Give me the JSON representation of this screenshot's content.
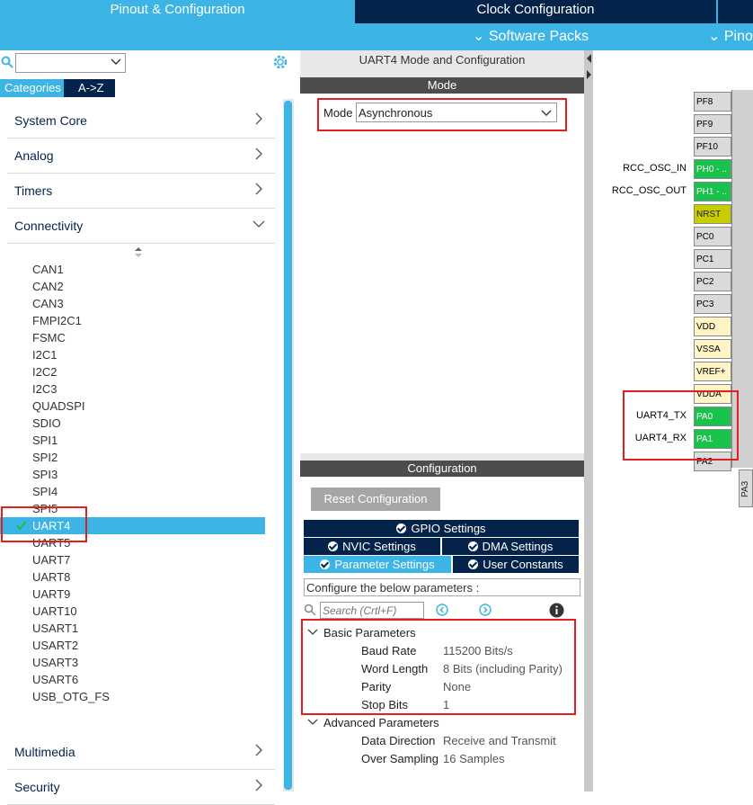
{
  "top_tabs": {
    "pinout": "Pinout & Configuration",
    "clock": "Clock Configuration"
  },
  "sub_menu": {
    "software_packs": "Software Packs",
    "pinout": "Pinout"
  },
  "left": {
    "search_value": "",
    "cat_tabs": [
      "Categories",
      "A->Z"
    ],
    "sections": [
      "System Core",
      "Analog",
      "Timers",
      "Connectivity"
    ],
    "bottom_sections": [
      "Multimedia",
      "Security"
    ],
    "peripherals": [
      "CAN1",
      "CAN2",
      "CAN3",
      "FMPI2C1",
      "FSMC",
      "I2C1",
      "I2C2",
      "I2C3",
      "QUADSPI",
      "SDIO",
      "SPI1",
      "SPI2",
      "SPI3",
      "SPI4",
      "SPI5",
      "UART4",
      "UART5",
      "UART7",
      "UART8",
      "UART9",
      "UART10",
      "USART1",
      "USART2",
      "USART3",
      "USART6",
      "USB_OTG_FS"
    ],
    "selected": "UART4"
  },
  "middle": {
    "title": "UART4 Mode and Configuration",
    "mode_header": "Mode",
    "mode_label": "Mode",
    "mode_value": "Asynchronous",
    "config_header": "Configuration",
    "reset_button": "Reset Configuration",
    "tabs": {
      "gpio": "GPIO Settings",
      "nvic": "NVIC Settings",
      "dma": "DMA Settings",
      "param": "Parameter Settings",
      "user": "User Constants"
    },
    "configure_text": "Configure the below parameters :",
    "search_placeholder": "Search (Crtl+F)",
    "basic": {
      "title": "Basic Parameters",
      "rows": [
        {
          "label": "Baud Rate",
          "value": "115200 Bits/s"
        },
        {
          "label": "Word Length",
          "value": "8 Bits (including Parity)"
        },
        {
          "label": "Parity",
          "value": "None"
        },
        {
          "label": "Stop Bits",
          "value": "1"
        }
      ]
    },
    "advanced": {
      "title": "Advanced Parameters",
      "rows": [
        {
          "label": "Data Direction",
          "value": "Receive and Transmit"
        },
        {
          "label": "Over Sampling",
          "value": "16 Samples"
        }
      ]
    }
  },
  "right": {
    "pins": [
      {
        "name": "PF8",
        "color": "gray",
        "label": ""
      },
      {
        "name": "PF9",
        "color": "gray",
        "label": ""
      },
      {
        "name": "PF10",
        "color": "gray",
        "label": ""
      },
      {
        "name": "PH0 - ..",
        "color": "green",
        "label": "RCC_OSC_IN"
      },
      {
        "name": "PH1 - ..",
        "color": "green",
        "label": "RCC_OSC_OUT"
      },
      {
        "name": "NRST",
        "color": "olive",
        "label": ""
      },
      {
        "name": "PC0",
        "color": "gray",
        "label": ""
      },
      {
        "name": "PC1",
        "color": "gray",
        "label": ""
      },
      {
        "name": "PC2",
        "color": "gray",
        "label": ""
      },
      {
        "name": "PC3",
        "color": "gray",
        "label": ""
      },
      {
        "name": "VDD",
        "color": "yellow",
        "label": ""
      },
      {
        "name": "VSSA",
        "color": "yellow",
        "label": ""
      },
      {
        "name": "VREF+",
        "color": "yellow",
        "label": ""
      },
      {
        "name": "VDDA",
        "color": "yellow",
        "label": ""
      },
      {
        "name": "PA0",
        "color": "green",
        "label": "UART4_TX"
      },
      {
        "name": "PA1",
        "color": "green",
        "label": "UART4_RX"
      },
      {
        "name": "PA2",
        "color": "gray",
        "label": ""
      }
    ],
    "bottom_pin": "PA3"
  },
  "colors": {
    "accent": "#3cb4e6",
    "dark": "#03234b",
    "highlight": "#e41e1e",
    "pin_green": "#19c24a"
  }
}
